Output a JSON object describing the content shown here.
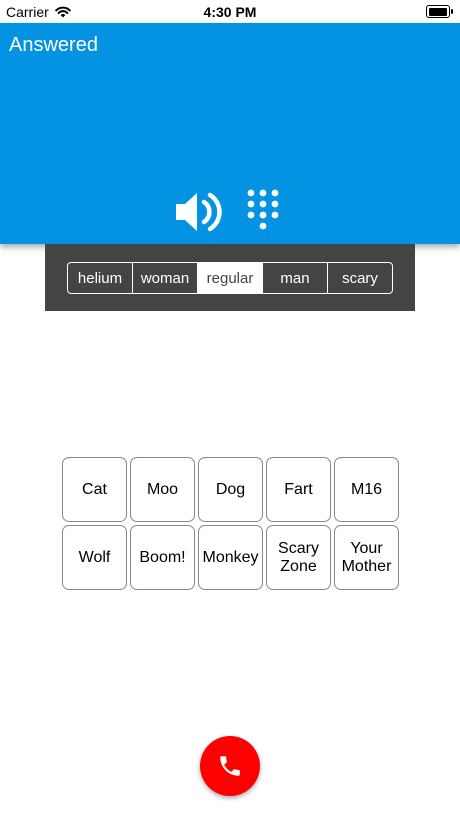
{
  "status_bar": {
    "carrier": "Carrier",
    "time": "4:30 PM",
    "battery_level": 0.85
  },
  "call": {
    "status": "Answered"
  },
  "controls": {
    "speaker_icon": "speaker-icon",
    "keypad_icon": "keypad-icon"
  },
  "voice_effects": {
    "options": [
      "helium",
      "woman",
      "regular",
      "man",
      "scary"
    ],
    "selected": "regular"
  },
  "sounds": [
    [
      "Cat",
      "Moo",
      "Dog",
      "Fart",
      "M16"
    ],
    [
      "Wolf",
      "Boom!",
      "Monkey",
      "Scary\nZone",
      "Your\nMother"
    ]
  ],
  "colors": {
    "header": "#0492e3",
    "panel": "#444444",
    "hangup": "#ff0000"
  },
  "hangup": {
    "icon": "phone-icon"
  }
}
